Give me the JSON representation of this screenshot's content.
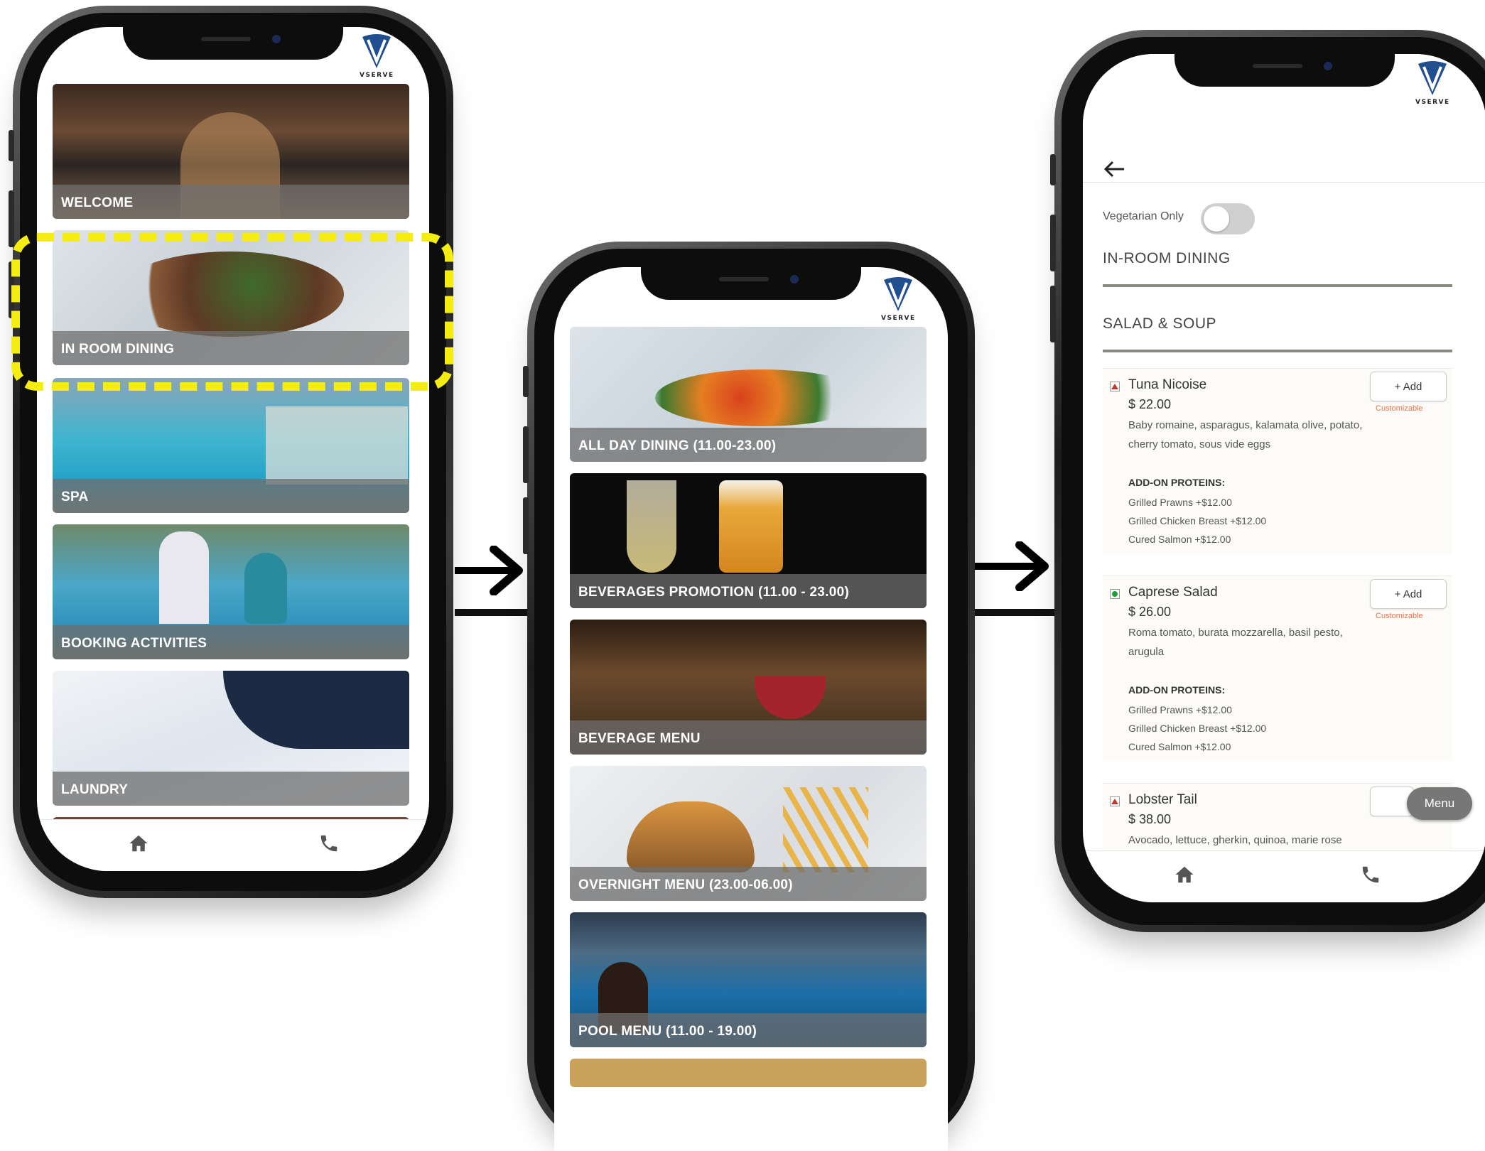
{
  "brand": {
    "logo_text": "VSERVE"
  },
  "home_screen": {
    "tiles": [
      {
        "label": "WELCOME"
      },
      {
        "label": "IN ROOM DINING"
      },
      {
        "label": "SPA"
      },
      {
        "label": "BOOKING ACTIVITIES"
      },
      {
        "label": "LAUNDRY"
      }
    ]
  },
  "dining_screen": {
    "tiles": [
      {
        "label": "ALL DAY DINING (11.00-23.00)"
      },
      {
        "label": "BEVERAGES PROMOTION (11.00 - 23.00)"
      },
      {
        "label": "BEVERAGE MENU"
      },
      {
        "label": "OVERNIGHT MENU (23.00-06.00)"
      },
      {
        "label": "POOL MENU (11.00 - 19.00)"
      }
    ]
  },
  "menu_screen": {
    "vegetarian_label": "Vegetarian Only",
    "vegetarian_on": false,
    "category": "IN-ROOM DINING",
    "section": "SALAD & SOUP",
    "add_label": "+ Add",
    "customizable_label": "Customizable",
    "addon_heading": "ADD-ON PROTEINS:",
    "fab_label": "Menu",
    "items": [
      {
        "name": "Tuna Nicoise",
        "type": "non-veg",
        "price": "$ 22.00",
        "description": "Baby romaine, asparagus, kalamata olive, potato, cherry tomato, sous vide eggs",
        "addons": [
          "Grilled Prawns +$12.00",
          "Grilled Chicken Breast +$12.00",
          "Cured Salmon +$12.00"
        ]
      },
      {
        "name": "Caprese Salad",
        "type": "veg",
        "price": "$ 26.00",
        "description": "Roma tomato, burata mozzarella, basil pesto, arugula",
        "addons": [
          "Grilled Prawns +$12.00",
          "Grilled Chicken Breast +$12.00",
          "Cured Salmon +$12.00"
        ]
      },
      {
        "name": "Lobster Tail",
        "type": "non-veg",
        "price": "$ 38.00",
        "description": "Avocado, lettuce, gherkin, quinoa, marie rose sauce"
      }
    ]
  },
  "icons": {
    "home": "home-icon",
    "phone": "phone-icon",
    "back": "arrow-left-icon",
    "flow_arrow": "arrow-right-icon"
  },
  "colors": {
    "highlight": "#f5ec12",
    "logo_blue": "#1f4f8f",
    "customizable": "#e8734a",
    "veg": "#1e9e3a",
    "non_veg": "#c0392b"
  }
}
